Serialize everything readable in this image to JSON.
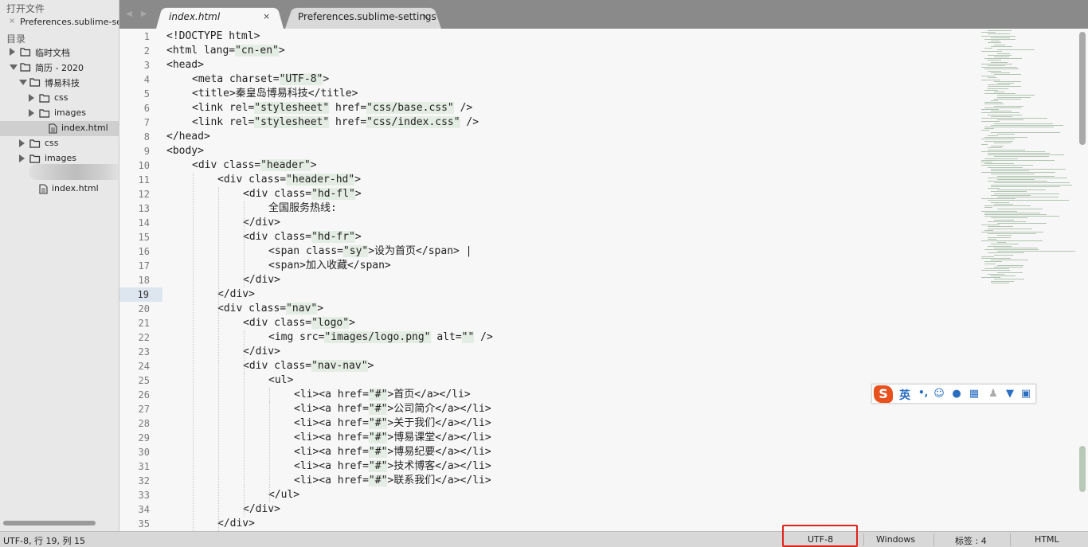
{
  "sidebar": {
    "open_files_title": "打开文件",
    "open_files": [
      {
        "name": "Preferences.sublime-settings",
        "close": "×"
      }
    ],
    "folders_title": "目录",
    "tree": [
      {
        "label": "临时文档",
        "depth": 0,
        "type": "folder",
        "state": "collapsed"
      },
      {
        "label": "简历 - 2020",
        "depth": 0,
        "type": "folder",
        "state": "expanded"
      },
      {
        "label": "博易科技",
        "depth": 1,
        "type": "folder",
        "state": "expanded"
      },
      {
        "label": "css",
        "depth": 2,
        "type": "folder",
        "state": "collapsed"
      },
      {
        "label": "images",
        "depth": 2,
        "type": "folder",
        "state": "collapsed"
      },
      {
        "label": "index.html",
        "depth": 2,
        "type": "file",
        "selected": true
      },
      {
        "label": "css",
        "depth": 1,
        "type": "folder",
        "state": "collapsed"
      },
      {
        "label": "images",
        "depth": 1,
        "type": "folder",
        "state": "collapsed"
      },
      {
        "label": "index.html",
        "depth": 1,
        "type": "file"
      }
    ]
  },
  "tabs": [
    {
      "label": "index.html",
      "active": true,
      "close": "×"
    },
    {
      "label": "Preferences.sublime-settings",
      "active": false,
      "close": "×"
    }
  ],
  "tab_nav": "◀ ▶",
  "editor": {
    "current_line": 19,
    "lines": [
      {
        "n": "1",
        "indent": 0,
        "text": "<!DOCTYPE html>"
      },
      {
        "n": "2",
        "indent": 0,
        "text": "<html lang=\"cn-en\">"
      },
      {
        "n": "3",
        "indent": 0,
        "text": "<head>"
      },
      {
        "n": "4",
        "indent": 1,
        "text": "<meta charset=\"UTF-8\">"
      },
      {
        "n": "5",
        "indent": 1,
        "text": "<title>秦皇岛博易科技</title>"
      },
      {
        "n": "6",
        "indent": 1,
        "text": "<link rel=\"stylesheet\" href=\"css/base.css\" />"
      },
      {
        "n": "7",
        "indent": 1,
        "text": "<link rel=\"stylesheet\" href=\"css/index.css\" />"
      },
      {
        "n": "8",
        "indent": 0,
        "text": "</head>"
      },
      {
        "n": "9",
        "indent": 0,
        "text": "<body>"
      },
      {
        "n": "10",
        "indent": 1,
        "text": "<div class=\"header\">"
      },
      {
        "n": "11",
        "indent": 2,
        "text": "<div class=\"header-hd\">"
      },
      {
        "n": "12",
        "indent": 3,
        "text": "<div class=\"hd-fl\">"
      },
      {
        "n": "13",
        "indent": 4,
        "text": "全国服务热线:"
      },
      {
        "n": "14",
        "indent": 3,
        "text": "</div>"
      },
      {
        "n": "15",
        "indent": 3,
        "text": "<div class=\"hd-fr\">"
      },
      {
        "n": "16",
        "indent": 4,
        "text": "<span class=\"sy\">设为首页</span> |"
      },
      {
        "n": "17",
        "indent": 4,
        "text": "<span>加入收藏</span>"
      },
      {
        "n": "18",
        "indent": 3,
        "text": "</div>"
      },
      {
        "n": "19",
        "indent": 2,
        "text": "</div>"
      },
      {
        "n": "20",
        "indent": 2,
        "text": "<div class=\"nav\">"
      },
      {
        "n": "21",
        "indent": 3,
        "text": "<div class=\"logo\">"
      },
      {
        "n": "22",
        "indent": 4,
        "text": "<img src=\"images/logo.png\" alt=\"\" />"
      },
      {
        "n": "23",
        "indent": 3,
        "text": "</div>"
      },
      {
        "n": "24",
        "indent": 3,
        "text": "<div class=\"nav-nav\">"
      },
      {
        "n": "25",
        "indent": 4,
        "text": "<ul>"
      },
      {
        "n": "26",
        "indent": 5,
        "text": "<li><a href=\"#\">首页</a></li>"
      },
      {
        "n": "27",
        "indent": 5,
        "text": "<li><a href=\"#\">公司简介</a></li>"
      },
      {
        "n": "28",
        "indent": 5,
        "text": "<li><a href=\"#\">关于我们</a></li>"
      },
      {
        "n": "29",
        "indent": 5,
        "text": "<li><a href=\"#\">博易课堂</a></li>"
      },
      {
        "n": "30",
        "indent": 5,
        "text": "<li><a href=\"#\">博易纪要</a></li>"
      },
      {
        "n": "31",
        "indent": 5,
        "text": "<li><a href=\"#\">技术博客</a></li>"
      },
      {
        "n": "32",
        "indent": 5,
        "text": "<li><a href=\"#\">联系我们</a></li>"
      },
      {
        "n": "33",
        "indent": 4,
        "text": "</ul>"
      },
      {
        "n": "34",
        "indent": 3,
        "text": "</div>"
      },
      {
        "n": "35",
        "indent": 2,
        "text": "</div>"
      }
    ]
  },
  "ime_toolbar": {
    "logo": "S",
    "mode": "英",
    "punct": "•,",
    "icons": [
      "emoji-icon",
      "mic-icon",
      "keyboard-icon",
      "user-icon",
      "skin-icon",
      "grid-icon"
    ]
  },
  "statusbar": {
    "position": "UTF-8, 行 19, 列 15",
    "encoding": "UTF-8",
    "line_endings": "Windows",
    "indent": "标签 : 4",
    "syntax": "HTML"
  },
  "colors": {
    "highlight_box": "#e0241a",
    "string_bg": "#e4ede4",
    "current_line_bg": "#dde6ef"
  }
}
